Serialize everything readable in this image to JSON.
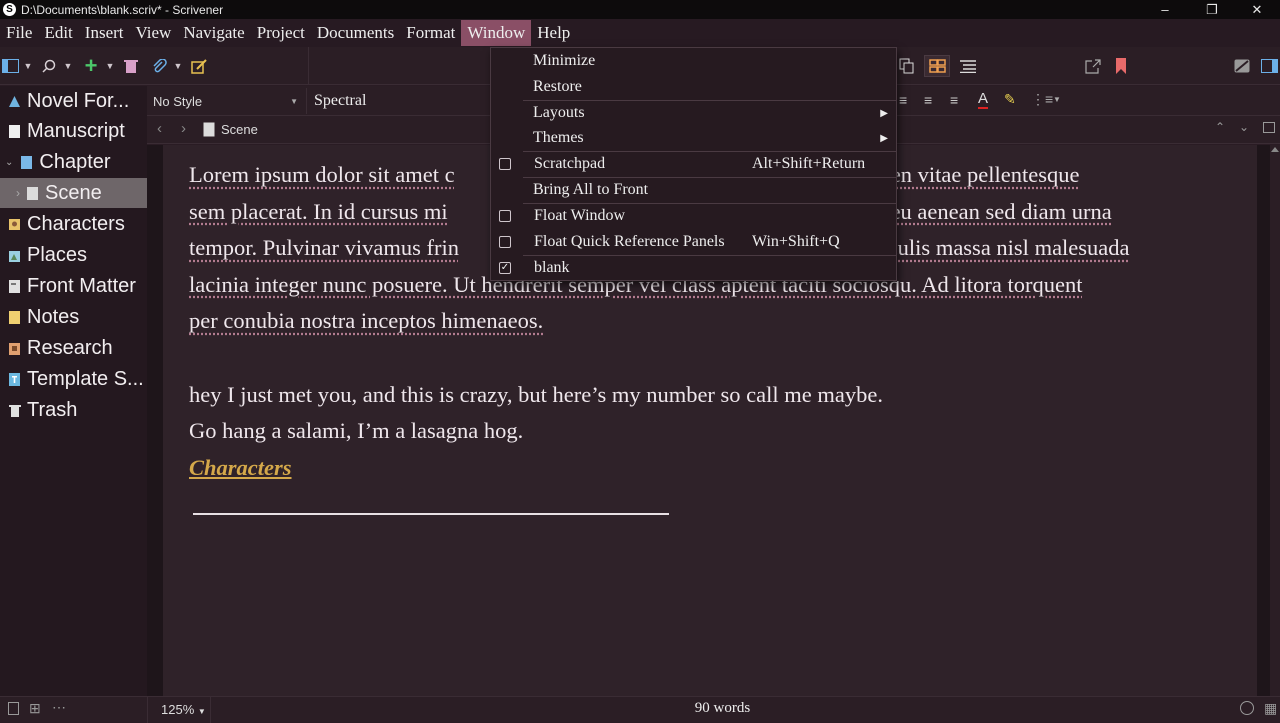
{
  "window": {
    "title": "D:\\Documents\\blank.scriv* - Scrivener",
    "app_icon": "S"
  },
  "menubar": {
    "items": [
      {
        "label": "File"
      },
      {
        "label": "Edit"
      },
      {
        "label": "Insert"
      },
      {
        "label": "View"
      },
      {
        "label": "Navigate"
      },
      {
        "label": "Project"
      },
      {
        "label": "Documents"
      },
      {
        "label": "Format"
      },
      {
        "label": "Window"
      },
      {
        "label": "Help"
      }
    ]
  },
  "format_bar": {
    "style": "No Style",
    "font": "Spectral"
  },
  "header": {
    "doc_title": "Scene"
  },
  "binder": {
    "items": [
      {
        "label": "Novel For...",
        "icon": "novel-icon",
        "color": "#6fb3e0"
      },
      {
        "label": "Manuscript",
        "icon": "manuscript-icon",
        "color": "#f0f0f0"
      },
      {
        "label": "Chapter",
        "icon": "chapter-icon",
        "color": "#7ab8e8"
      },
      {
        "label": "Scene",
        "icon": "scene-icon",
        "color": "#dcdcdc"
      },
      {
        "label": "Characters",
        "icon": "characters-icon",
        "color": "#e8c36a"
      },
      {
        "label": "Places",
        "icon": "places-icon",
        "color": "#9ad0e0"
      },
      {
        "label": "Front Matter",
        "icon": "front-matter-icon",
        "color": "#e0e0e0"
      },
      {
        "label": "Notes",
        "icon": "notes-icon",
        "color": "#f0d070"
      },
      {
        "label": "Research",
        "icon": "research-icon",
        "color": "#e0a070"
      },
      {
        "label": "Template S...",
        "icon": "template-icon",
        "color": "#6cb8e0"
      },
      {
        "label": "Trash",
        "icon": "trash-icon",
        "color": "#e0e0e0"
      }
    ]
  },
  "editor": {
    "p1": [
      [
        "Lorem",
        true
      ],
      [
        " ",
        false
      ],
      [
        "ipsum",
        true
      ],
      [
        " dolor sit ",
        false
      ],
      [
        "amet",
        true
      ],
      [
        " c",
        false
      ],
      [
        "...",
        false
      ]
    ],
    "lorem_line1_left": "Lorem ipsum dolor sit amet c",
    "lorem_line1_right": "ibus ex sapien vitae pellentesque",
    "lorem_line2_left": "sem placerat. In id cursus mi",
    "lorem_line2_right": "o eu aenean sed diam urna",
    "lorem_line3_left": "tempor. Pulvinar vivamus frin",
    "lorem_line3_right": ". Iaculis massa nisl malesuada",
    "lorem_line4": "lacinia integer nunc posuere. Ut hendrerit semper vel class aptent taciti sociosqu. Ad litora torquent",
    "lorem_line5": "per conubia nostra inceptos himenaeos.",
    "line_a": "hey I just met you, and this is crazy, but here’s my number so call me maybe.",
    "line_b": "Go hang a salami, I’m a lasagna hog.",
    "link": "Characters"
  },
  "footer": {
    "zoom": "125%",
    "word_count": "90 words"
  },
  "window_menu": {
    "items": [
      {
        "label": "Minimize",
        "type": "plain"
      },
      {
        "label": "Restore",
        "type": "plain"
      },
      {
        "label": "Layouts",
        "type": "submenu"
      },
      {
        "label": "Themes",
        "type": "submenu"
      },
      {
        "label": "Scratchpad",
        "type": "check",
        "checked": false,
        "shortcut": "Alt+Shift+Return"
      },
      {
        "label": "Bring All to Front",
        "type": "plain"
      },
      {
        "label": "Float Window",
        "type": "check",
        "checked": false
      },
      {
        "label": "Float Quick Reference Panels",
        "type": "check",
        "checked": false,
        "shortcut": "Win+Shift+Q"
      },
      {
        "label": "blank",
        "type": "check",
        "checked": true
      }
    ]
  },
  "colors": {
    "accent_menu": "#8a4f66",
    "link": "#d4a84a",
    "bookmark": "#e86a6a"
  }
}
